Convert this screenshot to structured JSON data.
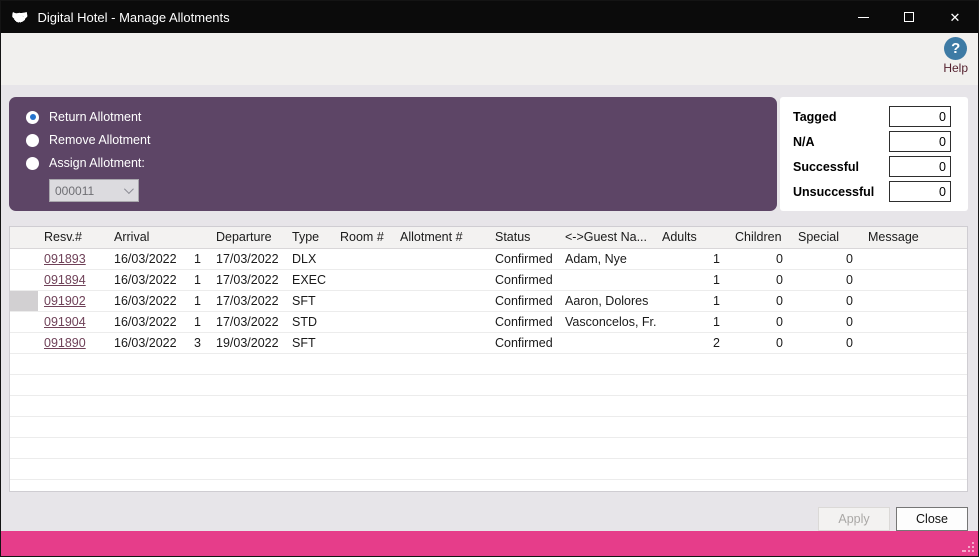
{
  "window": {
    "title": "Digital Hotel - Manage Allotments"
  },
  "toolbar": {
    "help_label": "Help"
  },
  "options_panel": {
    "radios": [
      {
        "label": "Return Allotment",
        "selected": true
      },
      {
        "label": "Remove Allotment",
        "selected": false
      },
      {
        "label": "Assign Allotment:",
        "selected": false
      }
    ],
    "allotment_number": {
      "value": "000011",
      "disabled": true
    }
  },
  "stats_panel": {
    "rows": [
      {
        "label": "Tagged",
        "value": "0"
      },
      {
        "label": "N/A",
        "value": "0"
      },
      {
        "label": "Successful",
        "value": "0"
      },
      {
        "label": "Unsuccessful",
        "value": "0"
      }
    ]
  },
  "grid": {
    "columns": [
      "",
      "Resv.#",
      "Arrival",
      "",
      "Departure",
      "Type",
      "Room #",
      "Allotment #",
      "Status",
      "<->Guest Na...",
      "Adults",
      "Children",
      "Special",
      "Message"
    ],
    "rows": [
      {
        "resv": "091893",
        "arrival": "16/03/2022",
        "nights": "1",
        "departure": "17/03/2022",
        "type": "DLX",
        "room": "",
        "allotment": "",
        "status": "Confirmed",
        "guest": "Adam, Nye",
        "adults": "1",
        "children": "0",
        "special": "0",
        "message": "",
        "selected": false
      },
      {
        "resv": "091894",
        "arrival": "16/03/2022",
        "nights": "1",
        "departure": "17/03/2022",
        "type": "EXEC",
        "room": "",
        "allotment": "",
        "status": "Confirmed",
        "guest": "",
        "adults": "1",
        "children": "0",
        "special": "0",
        "message": "",
        "selected": false
      },
      {
        "resv": "091902",
        "arrival": "16/03/2022",
        "nights": "1",
        "departure": "17/03/2022",
        "type": "SFT",
        "room": "",
        "allotment": "",
        "status": "Confirmed",
        "guest": "Aaron, Dolores",
        "adults": "1",
        "children": "0",
        "special": "0",
        "message": "",
        "selected": true
      },
      {
        "resv": "091904",
        "arrival": "16/03/2022",
        "nights": "1",
        "departure": "17/03/2022",
        "type": "STD",
        "room": "",
        "allotment": "",
        "status": "Confirmed",
        "guest": "Vasconcelos, Fr...",
        "adults": "1",
        "children": "0",
        "special": "0",
        "message": "",
        "selected": false
      },
      {
        "resv": "091890",
        "arrival": "16/03/2022",
        "nights": "3",
        "departure": "19/03/2022",
        "type": "SFT",
        "room": "",
        "allotment": "",
        "status": "Confirmed",
        "guest": "",
        "adults": "2",
        "children": "0",
        "special": "0",
        "message": "",
        "selected": false
      }
    ]
  },
  "actions": {
    "apply_label": "Apply",
    "apply_enabled": false,
    "close_label": "Close"
  },
  "colors": {
    "titlebar": "#0b0b0b",
    "panel_purple": "#5d4566",
    "status_pink": "#e63d8a",
    "help_icon_blue": "#3e7ba5",
    "link_maroon": "#6f4158",
    "radio_selected_blue": "#2573ce"
  }
}
